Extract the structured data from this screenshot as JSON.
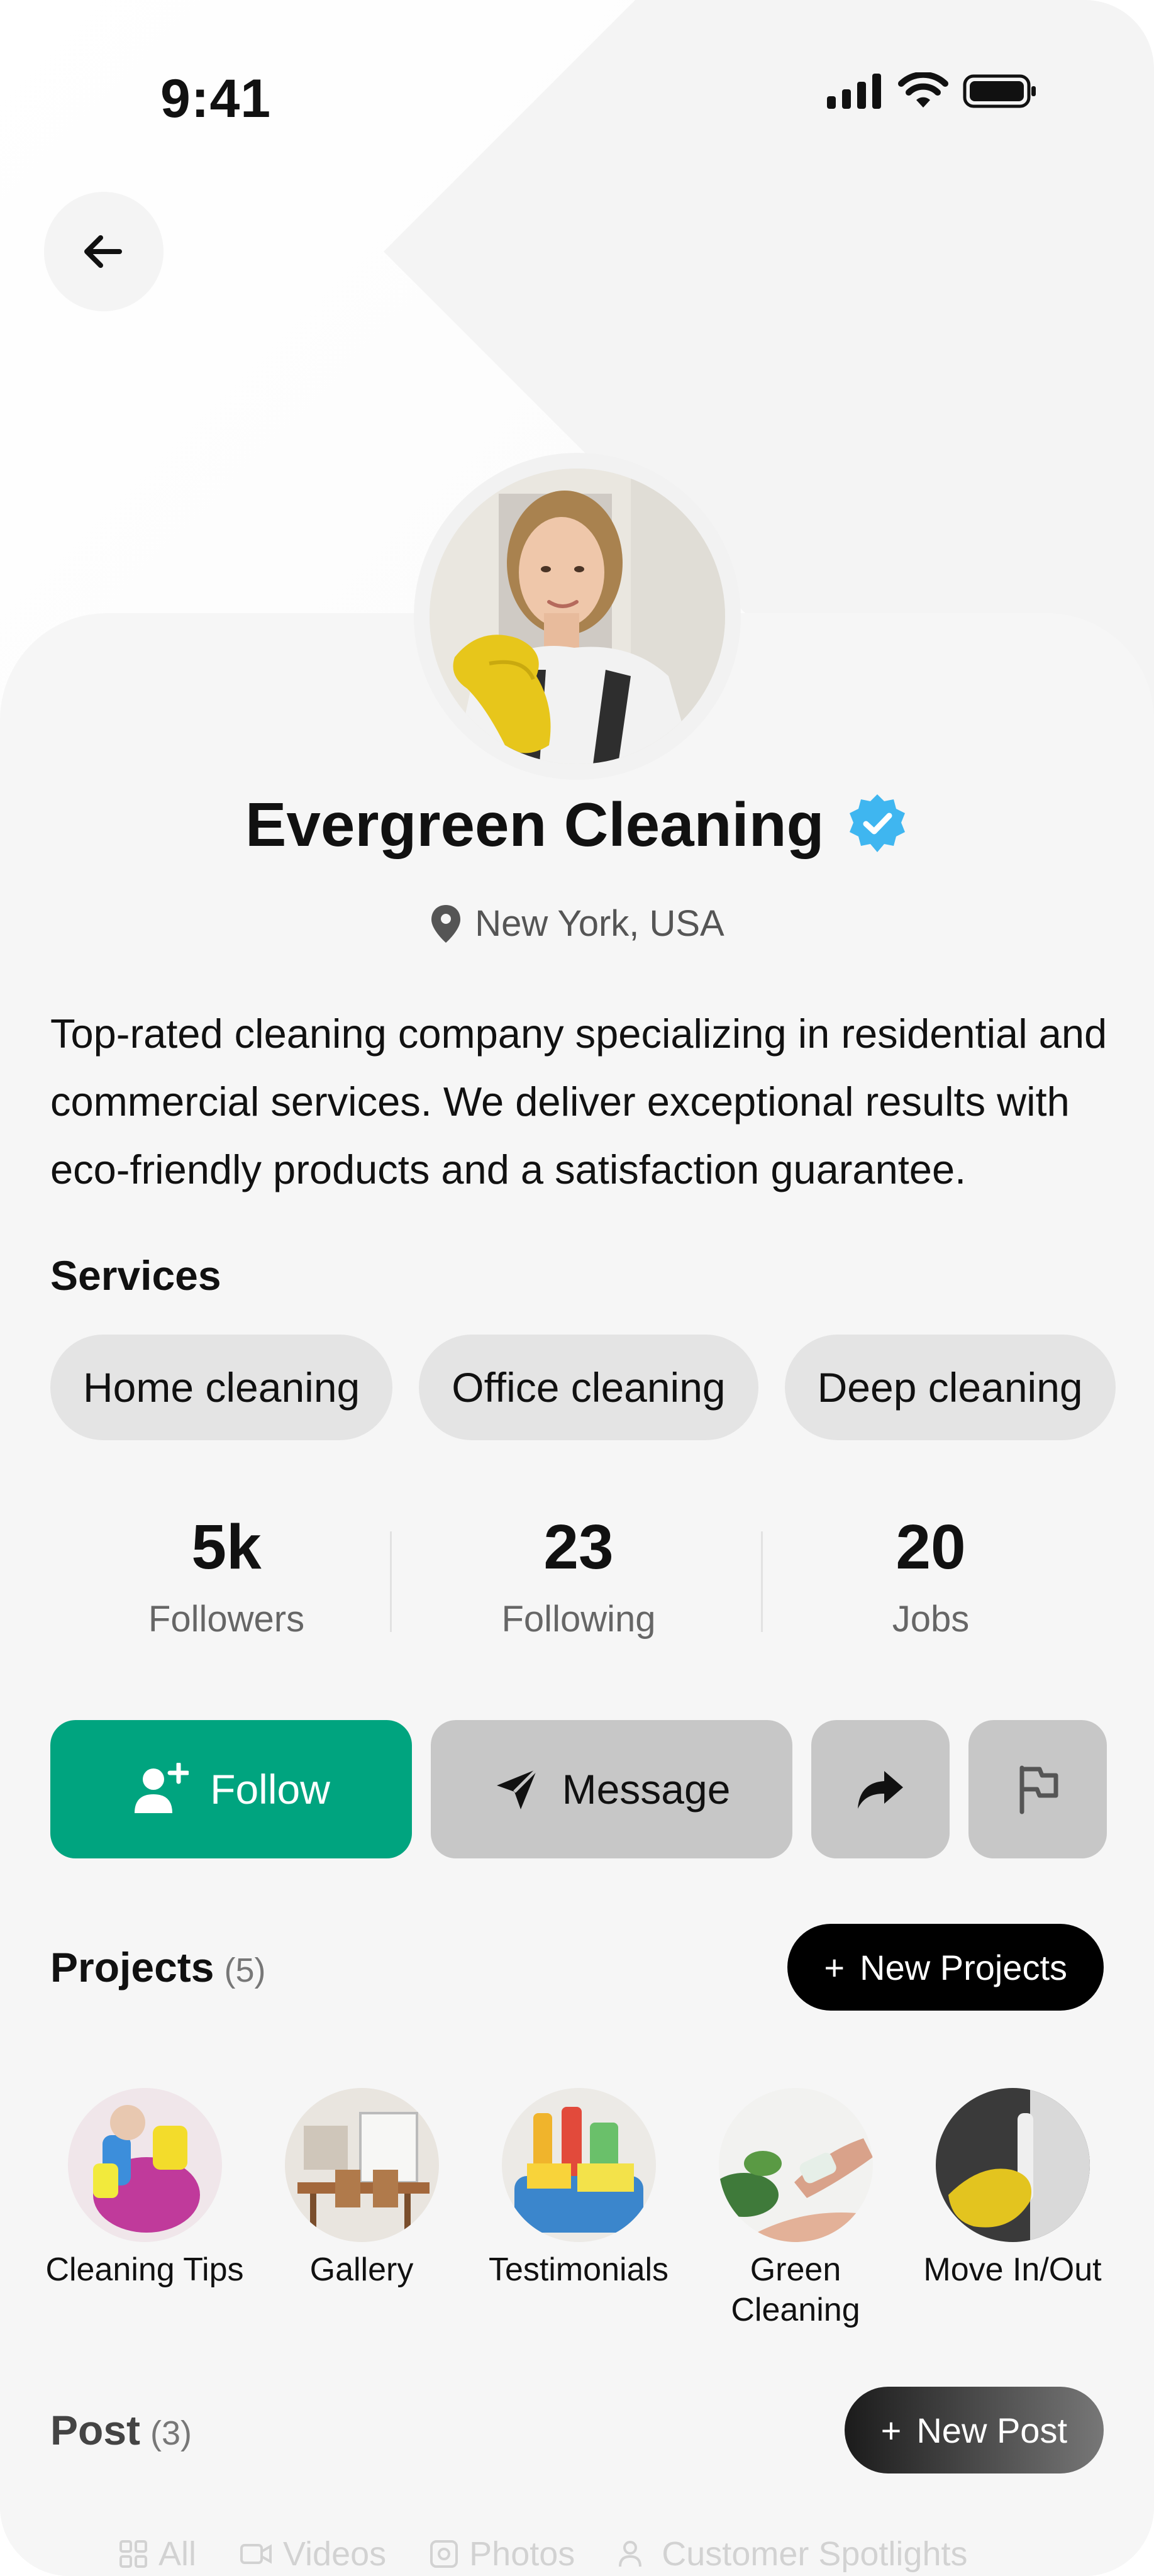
{
  "status_bar": {
    "time": "9:41"
  },
  "profile": {
    "name": "Evergreen Cleaning",
    "location": "New York, USA",
    "bio": "Top-rated cleaning company specializing in residential and commercial services. We deliver exceptional results with eco-friendly products and a satisfaction guarantee."
  },
  "services": {
    "title": "Services",
    "items": [
      "Home cleaning",
      "Office cleaning",
      "Deep cleaning"
    ]
  },
  "stats": [
    {
      "value": "5k",
      "label": "Followers"
    },
    {
      "value": "23",
      "label": "Following"
    },
    {
      "value": "20",
      "label": "Jobs"
    }
  ],
  "actions": {
    "follow_label": "Follow",
    "message_label": "Message",
    "share_icon": "share-arrow-icon",
    "report_icon": "flag-icon"
  },
  "projects": {
    "title": "Projects",
    "count": "(5)",
    "new_label": "New Projects",
    "items": [
      {
        "label": "Cleaning Tips"
      },
      {
        "label": "Gallery"
      },
      {
        "label": "Testimonials"
      },
      {
        "label": "Green Cleaning"
      },
      {
        "label": "Move In/Out"
      }
    ]
  },
  "posts": {
    "title": "Post",
    "count": "(3)",
    "new_label": "New Post",
    "tabs": [
      "All",
      "Videos",
      "Photos",
      "Customer Spotlights"
    ]
  },
  "colors": {
    "accent": "#00a47f",
    "verified": "#3fb6f0",
    "chip_bg": "#e4e4e4",
    "button_gray": "#c7c7c7"
  }
}
